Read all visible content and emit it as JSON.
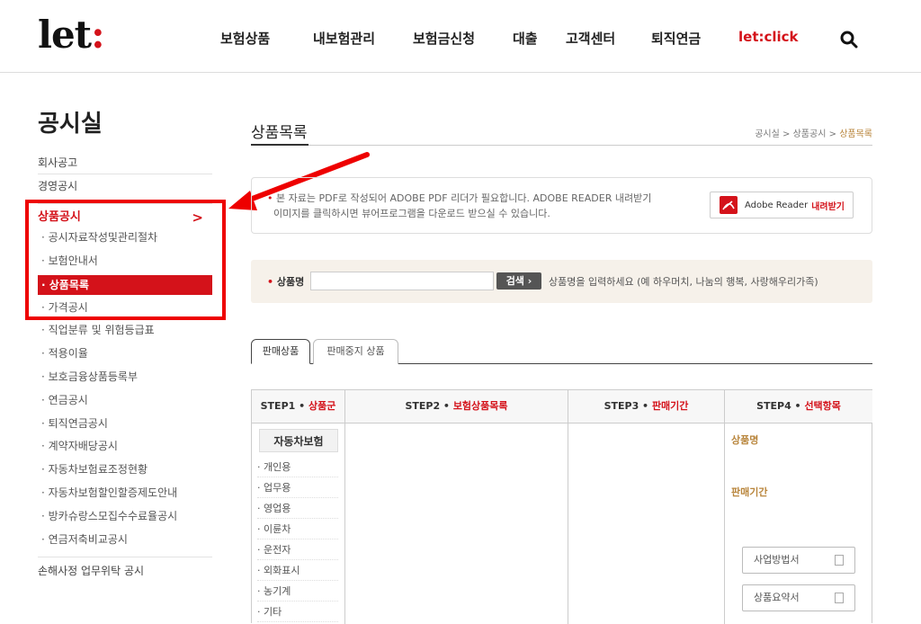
{
  "header": {
    "logo": "let",
    "logo_colon": ":",
    "nav": [
      "보험상품",
      "내보험관리",
      "보험금신청",
      "대출",
      "고객센터",
      "퇴직연금",
      "let:click"
    ]
  },
  "sidebar": {
    "title": "공시실",
    "top_items": [
      "회사공고",
      "경영공시"
    ],
    "section": "상품공시",
    "section_chevron": ">",
    "sub_items": [
      "공시자료작성및관리절차",
      "보험안내서",
      "상품목록",
      "가격공시",
      "직업분류 및 위험등급표",
      "적용이율",
      "보호금융상품등록부",
      "연금공시",
      "퇴직연금공시",
      "계약자배당공시",
      "자동차보험료조정현황",
      "자동차보험할인할증제도안내",
      "방카슈랑스모집수수료율공시",
      "연금저축비교공시"
    ],
    "last_item": "손해사정 업무위탁 공시"
  },
  "content": {
    "title": "상품목록",
    "breadcrumb": [
      "공시실",
      "상품공시",
      "상품목록"
    ],
    "breadcrumb_sep": ">",
    "notice_line1": "본 자료는 PDF로 작성되어 ADOBE PDF 리더가 필요합니다. ADOBE READER 내려받기",
    "notice_line2": "이미지를 클릭하시면 뷰어프로그램을 다운로드 받으실 수 있습니다.",
    "adobe_label": "Adobe Reader",
    "adobe_download": "내려받기",
    "search_label": "상품명",
    "search_value": "",
    "search_button": "검색 ›",
    "search_hint": "상품명을 입력하세요 (예 하우머치, 나눔의 행복, 사랑해우리가족)",
    "tabs": [
      "판매상품",
      "판매중지 상품"
    ],
    "steps": [
      {
        "prefix": "STEP1 •",
        "label": "상품군"
      },
      {
        "prefix": "STEP2 •",
        "label": "보험상품목록"
      },
      {
        "prefix": "STEP3 •",
        "label": "판매기간"
      },
      {
        "prefix": "STEP4 •",
        "label": "선택항목"
      }
    ],
    "category_head": "자동차보험",
    "categories": [
      "개인용",
      "업무용",
      "영업용",
      "이륜차",
      "운전자",
      "외화표시",
      "농기계",
      "기타"
    ],
    "option_product": "상품명",
    "option_period": "판매기간",
    "doc_buttons": [
      "사업방법서",
      "상품요약서"
    ]
  },
  "colors": {
    "accent": "#d4121a",
    "gold": "#b9863d",
    "annotation": "#ee0000"
  }
}
